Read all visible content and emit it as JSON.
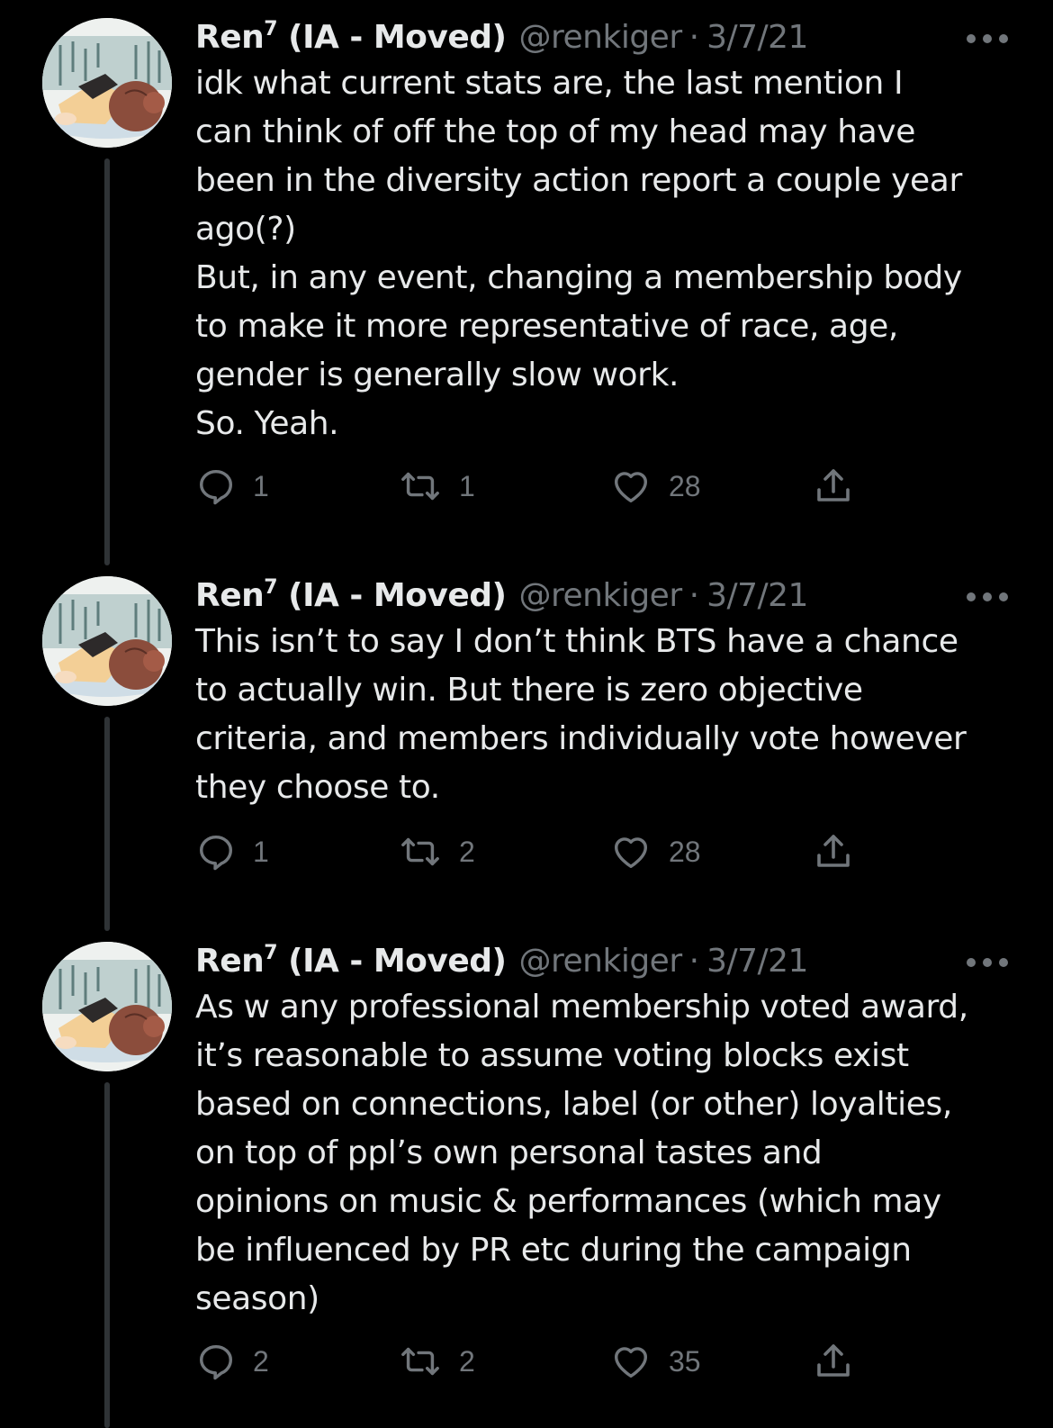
{
  "colors": {
    "background": "#000000",
    "text": "#e7e9ea",
    "secondary": "#71767b",
    "thread_line": "#2f3336"
  },
  "icons": {
    "reply": "reply-icon",
    "retweet": "retweet-icon",
    "like": "heart-icon",
    "share": "share-icon",
    "more": "more-icon"
  },
  "tweets": [
    {
      "author": {
        "name": "Ren",
        "superscript": "7",
        "name_suffix": " (IA - Moved)",
        "handle": "@renkiger"
      },
      "separator": "·",
      "date": "3/7/21",
      "text": "idk what current stats are, the last mention I\ncan think of off the top of my head may have\nbeen in the diversity action report a couple year\nago(?)\nBut, in any event, changing a membership body\nto make it more representative of race, age,\ngender is generally slow work.\nSo. Yeah.",
      "replies": "1",
      "retweets": "1",
      "likes": "28"
    },
    {
      "author": {
        "name": "Ren",
        "superscript": "7",
        "name_suffix": " (IA - Moved)",
        "handle": "@renkiger"
      },
      "separator": "·",
      "date": "3/7/21",
      "text": "This isn’t to say I don’t think BTS have a chance\nto actually win. But there is zero objective\ncriteria, and members individually vote however\nthey choose to.",
      "replies": "1",
      "retweets": "2",
      "likes": "28"
    },
    {
      "author": {
        "name": "Ren",
        "superscript": "7",
        "name_suffix": " (IA - Moved)",
        "handle": "@renkiger"
      },
      "separator": "·",
      "date": "3/7/21",
      "text": "As w any professional membership voted award,\nit’s reasonable to assume voting blocks exist\nbased on connections, label (or other) loyalties,\non top of ppl’s own personal tastes and\nopinions on music & performances (which may\nbe influenced by PR etc during the campaign\nseason)",
      "replies": "2",
      "retweets": "2",
      "likes": "35"
    }
  ]
}
